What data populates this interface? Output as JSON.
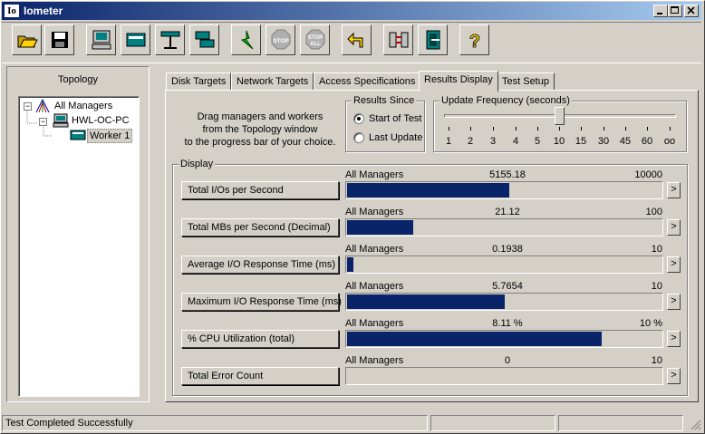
{
  "window": {
    "title": "Iometer",
    "icon_text": "Io"
  },
  "toolbar": {
    "buttons": [
      "open-icon",
      "save-icon",
      "new-manager-icon",
      "new-disk-worker-icon",
      "new-network-worker-icon",
      "duplicate-worker-icon",
      "start-icon",
      "stop-icon",
      "stop-all-icon",
      "reset-workers-icon",
      "disconnect-icon",
      "exit-icon",
      "help-icon"
    ],
    "stop_label": "STOP",
    "stop_all_label": "ALL",
    "help_label": "?"
  },
  "topology": {
    "label": "Topology",
    "tree": [
      "All Managers",
      "HWL-OC-PC",
      "Worker 1"
    ]
  },
  "tabs": [
    "Disk Targets",
    "Network Targets",
    "Access Specifications",
    "Results Display",
    "Test Setup"
  ],
  "active_tab": "Results Display",
  "instructions": {
    "line1": "Drag managers and workers",
    "line2": "from the Topology window",
    "line3": "to the progress bar of your choice."
  },
  "results_since": {
    "legend": "Results Since",
    "options": [
      "Start of Test",
      "Last Update"
    ],
    "selected": "Start of Test"
  },
  "update_frequency": {
    "legend": "Update Frequency (seconds)",
    "ticks": [
      "1",
      "2",
      "3",
      "4",
      "5",
      "10",
      "15",
      "30",
      "45",
      "60",
      "oo"
    ],
    "selected_index": 5
  },
  "display": {
    "legend": "Display",
    "source_label": "All Managers",
    "metrics": [
      {
        "name": "Total I/Os per Second",
        "value": "5155.18",
        "max": "10000",
        "fraction": 0.5155
      },
      {
        "name": "Total MBs per Second (Decimal)",
        "value": "21.12",
        "max": "100",
        "fraction": 0.2112
      },
      {
        "name": "Average I/O Response Time (ms)",
        "value": "0.1938",
        "max": "10",
        "fraction": 0.0194
      },
      {
        "name": "Maximum I/O Response Time (ms)",
        "value": "5.7654",
        "max": "10",
        "fraction": 0.5
      },
      {
        "name": "% CPU Utilization (total)",
        "value": "8.11 %",
        "max": "10 %",
        "fraction": 0.811
      },
      {
        "name": "Total Error Count",
        "value": "0",
        "max": "10",
        "fraction": 0
      }
    ],
    "arrow": ">"
  },
  "status": {
    "message": "Test Completed Successfully"
  },
  "colors": {
    "bar": "#0a246a",
    "face": "#d4d0c8"
  }
}
